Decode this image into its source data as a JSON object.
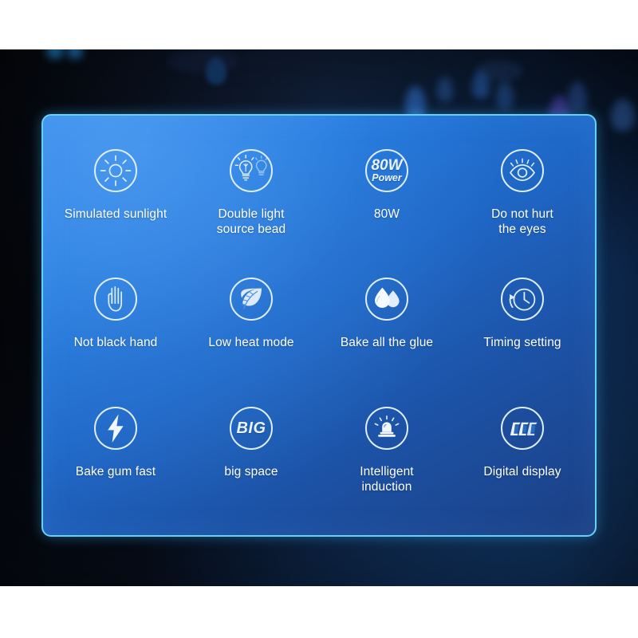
{
  "panel": {
    "border_color": "#63d2f5",
    "background_start": "#2680e8",
    "background_end": "#1b3f83",
    "label_color": "#ffffff"
  },
  "features": [
    {
      "label": "Simulated sunlight",
      "icon": "sun-icon",
      "name": "simulated-sunlight"
    },
    {
      "label": "Double light\nsource bead",
      "icon": "double-bulb-icon",
      "name": "double-light-source-bead"
    },
    {
      "label": "80W",
      "icon": "power-80w-icon",
      "name": "power-80w",
      "icon_text_main": "80W",
      "icon_text_sub": "Power"
    },
    {
      "label": "Do not hurt\nthe eyes",
      "icon": "eye-icon",
      "name": "do-not-hurt-the-eyes"
    },
    {
      "label": "Not black hand",
      "icon": "hand-icon",
      "name": "not-black-hand"
    },
    {
      "label": "Low heat mode",
      "icon": "leaf-icon",
      "name": "low-heat-mode"
    },
    {
      "label": "Bake all the glue",
      "icon": "water-drops-icon",
      "name": "bake-all-the-glue"
    },
    {
      "label": "Timing setting",
      "icon": "clock-history-icon",
      "name": "timing-setting"
    },
    {
      "label": "Bake gum fast",
      "icon": "lightning-bolt-icon",
      "name": "bake-gum-fast"
    },
    {
      "label": "big space",
      "icon": "big-text-icon",
      "name": "big-space",
      "icon_text_main": "BIG"
    },
    {
      "label": "Intelligent\ninduction",
      "icon": "siren-icon",
      "name": "intelligent-induction"
    },
    {
      "label": "Digital display",
      "icon": "seven-segment-icon",
      "name": "digital-display",
      "icon_text_main": "000"
    }
  ]
}
